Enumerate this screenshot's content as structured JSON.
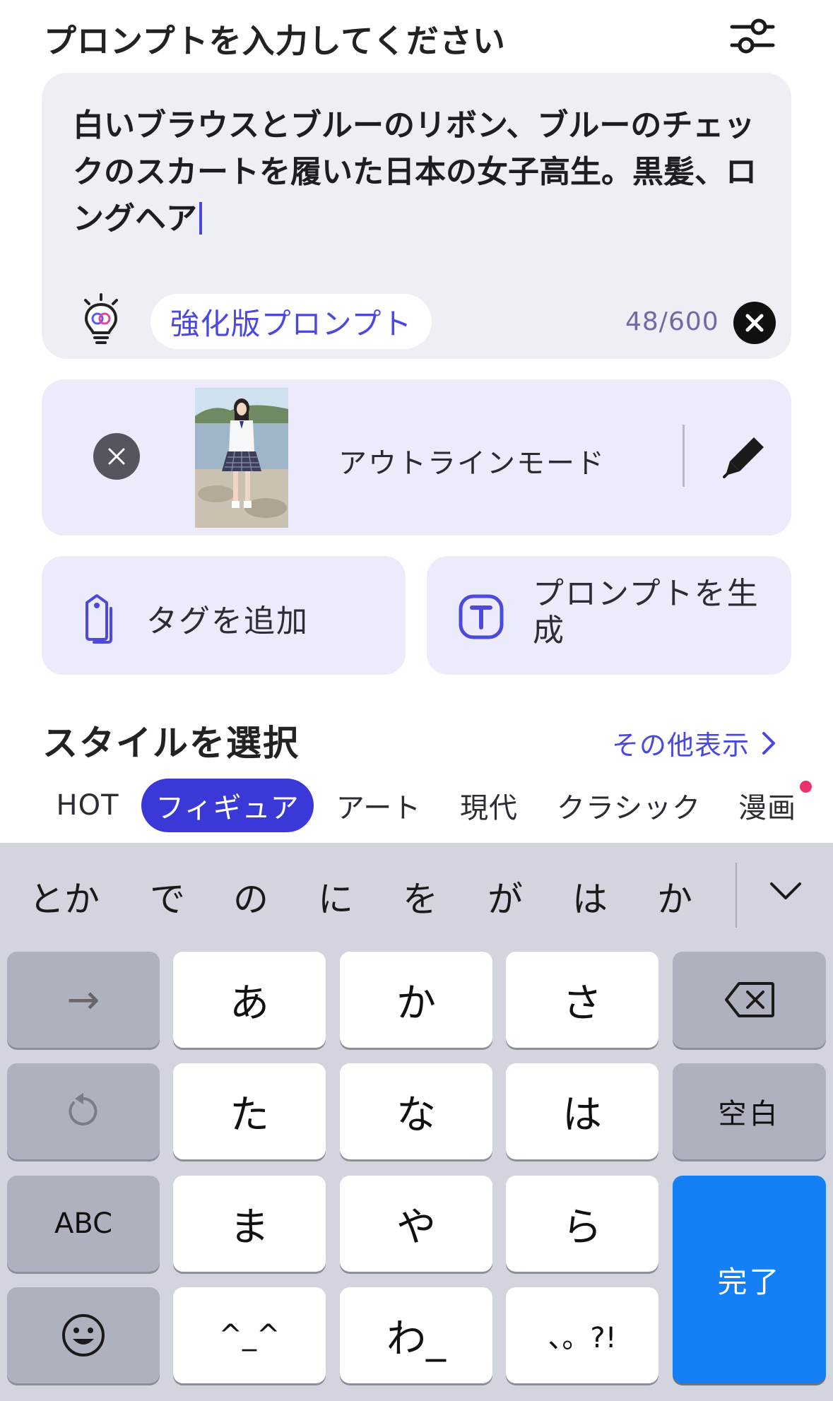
{
  "header": {
    "title": "プロンプトを入力してください",
    "settings_icon": "sliders-icon"
  },
  "prompt": {
    "text": "白いブラウスとブルーのリボン、ブルーのチェックのスカートを履いた日本の女子高生。黒髪、ロングヘア",
    "enhance_label": "強化版プロンプト",
    "counter": "48/600",
    "bulb_icon": "lightbulb-icon",
    "clear_icon": "close-icon"
  },
  "reference": {
    "mode_label": "アウトラインモード",
    "remove_icon": "close-icon",
    "edit_icon": "pen-icon"
  },
  "actions": {
    "tag_label": "タグを追加",
    "generate_label": "プロンプトを生成"
  },
  "styles": {
    "title": "スタイルを選択",
    "more_label": "その他表示",
    "tabs": [
      {
        "label": "HOT",
        "active": false
      },
      {
        "label": "フィギュア",
        "active": true
      },
      {
        "label": "アート",
        "active": false
      },
      {
        "label": "現代",
        "active": false
      },
      {
        "label": "クラシック",
        "active": false
      },
      {
        "label": "漫画",
        "active": false
      }
    ]
  },
  "keyboard": {
    "suggestions": [
      "とか",
      "で",
      "の",
      "に",
      "を",
      "が",
      "は",
      "か"
    ],
    "keys": {
      "next": "→",
      "a": "あ",
      "ka": "か",
      "sa": "さ",
      "ta": "た",
      "na": "な",
      "ha": "は",
      "space": "空白",
      "abc": "ABC",
      "ma": "ま",
      "ya": "や",
      "ra": "ら",
      "kaomoji": "^_^",
      "wa": "わ_",
      "punct": "、。?!",
      "done": "完了"
    },
    "accent_color": "#1580f5"
  },
  "colors": {
    "accent": "#3b38d8",
    "card": "#ebebfc",
    "notify": "#e8336d"
  }
}
